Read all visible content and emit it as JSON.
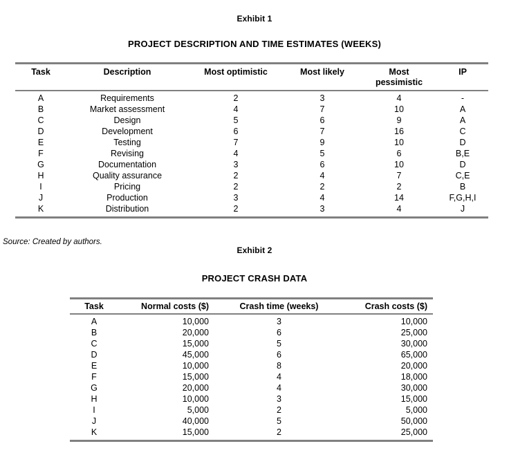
{
  "document": {
    "source_note": "Source: Created by authors."
  },
  "exhibit1": {
    "label": "Exhibit 1",
    "title": "PROJECT DESCRIPTION AND TIME ESTIMATES (WEEKS)",
    "columns": [
      "Task",
      "Description",
      "Most optimistic",
      "Most likely",
      "Most pessimistic",
      "IP"
    ],
    "columns_display": {
      "task": "Task",
      "description": "Description",
      "most_optimistic": "Most optimistic",
      "most_likely": "Most likely",
      "most_pessimistic_line1": "Most",
      "most_pessimistic_line2": "pessimistic",
      "ip": "IP"
    },
    "rows": [
      {
        "task": "A",
        "description": "Requirements",
        "most_optimistic": "2",
        "most_likely": "3",
        "most_pessimistic": "4",
        "ip": "-"
      },
      {
        "task": "B",
        "description": "Market assessment",
        "most_optimistic": "4",
        "most_likely": "7",
        "most_pessimistic": "10",
        "ip": "A"
      },
      {
        "task": "C",
        "description": "Design",
        "most_optimistic": "5",
        "most_likely": "6",
        "most_pessimistic": "9",
        "ip": "A"
      },
      {
        "task": "D",
        "description": "Development",
        "most_optimistic": "6",
        "most_likely": "7",
        "most_pessimistic": "16",
        "ip": "C"
      },
      {
        "task": "E",
        "description": "Testing",
        "most_optimistic": "7",
        "most_likely": "9",
        "most_pessimistic": "10",
        "ip": "D"
      },
      {
        "task": "F",
        "description": "Revising",
        "most_optimistic": "4",
        "most_likely": "5",
        "most_pessimistic": "6",
        "ip": "B,E"
      },
      {
        "task": "G",
        "description": "Documentation",
        "most_optimistic": "3",
        "most_likely": "6",
        "most_pessimistic": "10",
        "ip": "D"
      },
      {
        "task": "H",
        "description": "Quality assurance",
        "most_optimistic": "2",
        "most_likely": "4",
        "most_pessimistic": "7",
        "ip": "C,E"
      },
      {
        "task": "I",
        "description": "Pricing",
        "most_optimistic": "2",
        "most_likely": "2",
        "most_pessimistic": "2",
        "ip": "B"
      },
      {
        "task": "J",
        "description": "Production",
        "most_optimistic": "3",
        "most_likely": "4",
        "most_pessimistic": "14",
        "ip": "F,G,H,I"
      },
      {
        "task": "K",
        "description": "Distribution",
        "most_optimistic": "2",
        "most_likely": "3",
        "most_pessimistic": "4",
        "ip": "J"
      }
    ]
  },
  "exhibit2": {
    "label": "Exhibit 2",
    "title": "PROJECT CRASH DATA",
    "columns": [
      "Task",
      "Normal costs ($)",
      "Crash time (weeks)",
      "Crash costs ($)"
    ],
    "columns_display": {
      "task": "Task",
      "normal_costs": "Normal costs ($)",
      "crash_time": "Crash time (weeks)",
      "crash_costs": "Crash costs ($)"
    },
    "rows": [
      {
        "task": "A",
        "normal_costs": "10,000",
        "crash_time": "3",
        "crash_costs": "10,000"
      },
      {
        "task": "B",
        "normal_costs": "20,000",
        "crash_time": "6",
        "crash_costs": "25,000"
      },
      {
        "task": "C",
        "normal_costs": "15,000",
        "crash_time": "5",
        "crash_costs": "30,000"
      },
      {
        "task": "D",
        "normal_costs": "45,000",
        "crash_time": "6",
        "crash_costs": "65,000"
      },
      {
        "task": "E",
        "normal_costs": "10,000",
        "crash_time": "8",
        "crash_costs": "20,000"
      },
      {
        "task": "F",
        "normal_costs": "15,000",
        "crash_time": "4",
        "crash_costs": "18,000"
      },
      {
        "task": "G",
        "normal_costs": "20,000",
        "crash_time": "4",
        "crash_costs": "30,000"
      },
      {
        "task": "H",
        "normal_costs": "10,000",
        "crash_time": "3",
        "crash_costs": "15,000"
      },
      {
        "task": "I",
        "normal_costs": "5,000",
        "crash_time": "2",
        "crash_costs": "5,000"
      },
      {
        "task": "J",
        "normal_costs": "40,000",
        "crash_time": "5",
        "crash_costs": "50,000"
      },
      {
        "task": "K",
        "normal_costs": "15,000",
        "crash_time": "2",
        "crash_costs": "25,000"
      }
    ]
  },
  "colors": {
    "rule": "#808080",
    "text": "#000000",
    "background": "#ffffff"
  }
}
